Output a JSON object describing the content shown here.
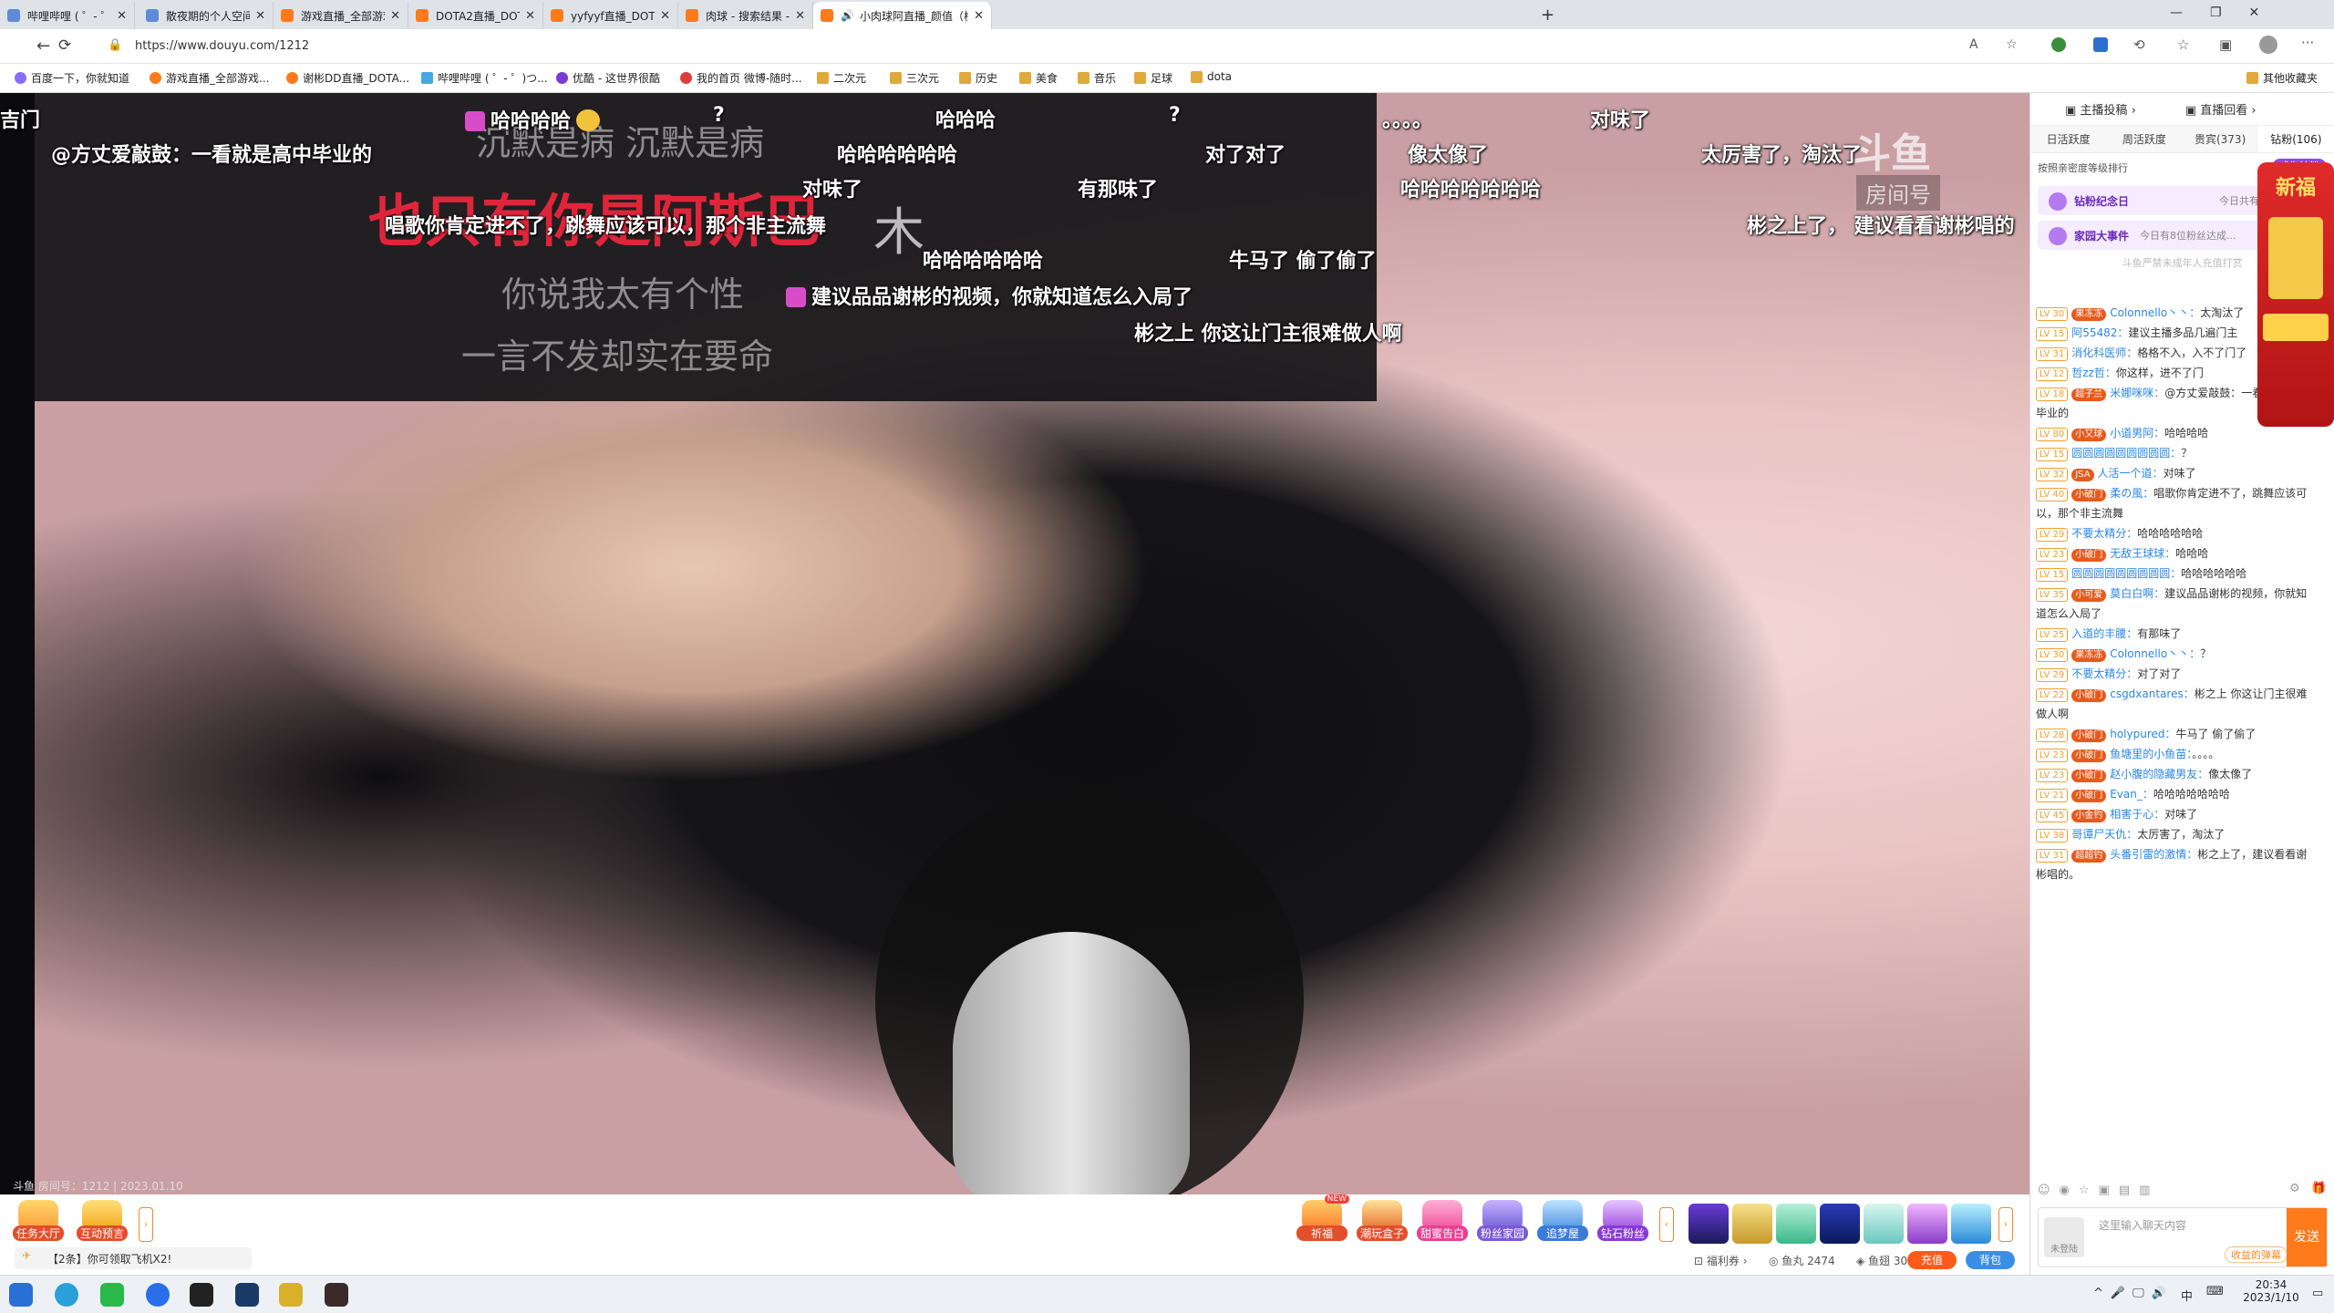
{
  "tabs": [
    {
      "title": "哔哩哔哩 ( ゜- ゜)つロ 干杯~-bili"
    },
    {
      "title": "散夜期的个人空间_哔哩哔哩_bili"
    },
    {
      "title": "游戏直播_全部游戏直播_斗鱼直播"
    },
    {
      "title": "DOTA2直播_DOTA2直播解说视频"
    },
    {
      "title": "yyfyyf直播_DOTA2直播_斗鱼直播"
    },
    {
      "title": "肉球 - 搜索结果 - 斗鱼直播 - 游戏"
    },
    {
      "title": "小肉球阿直播_颜值（横屏）"
    }
  ],
  "url": "https://www.douyu.com/1212",
  "bookmarks": [
    "百度一下，你就知道",
    "游戏直播_全部游戏...",
    "谢彬DD直播_DOTA...",
    "哔哩哔哩 ( ゜- ゜)つ...",
    "优酷 - 这世界很酷",
    "我的首页 微博-随时...",
    "二次元",
    "三次元",
    "历史",
    "美食",
    "音乐",
    "足球",
    "dota"
  ],
  "bookmark_other": "其他收藏夹",
  "lyrics": [
    "沉默是病 沉默是病",
    "也只有你是阿斯巴",
    "木",
    "你说我太有个性",
    "一言不发却实在要命"
  ],
  "danmaku": [
    "哈哈哈哈",
    "?",
    "哈哈哈",
    "?",
    "。。。。",
    "对味了",
    "@方丈爱敲鼓：一看就是高中毕业的",
    "哈哈哈哈哈哈",
    "对了对了",
    "像太像了",
    "太厉害了，淘汰了",
    "对味了",
    "有那味了",
    "哈哈哈哈哈哈哈",
    "唱歌你肯定进不了，跳舞应该可以，那个非主流舞",
    "彬之上了， 建议看看谢彬唱的",
    "哈哈哈哈哈哈",
    "牛马了 偷了偷了",
    "建议品品谢彬的视频，你就知道怎么入局了",
    "彬之上 你这让门主很难做人啊",
    "吉门"
  ],
  "watermark": "斗鱼",
  "watermark_sub": "房间号",
  "room_info": "斗鱼 房间号：1212 | 2023.01.10",
  "bottom": {
    "task": "任务大厅",
    "interact": "互动预言",
    "ticker": "【2条】你可领取飞机X2!",
    "gifts": [
      "祈福",
      "潮玩盒子",
      "甜蜜告白",
      "粉丝家园",
      "追梦屋",
      "钻石粉丝"
    ],
    "welfare": "福利券",
    "fishball_label": "鱼丸",
    "fishball": "2474",
    "fishwing_label": "鱼翅",
    "fishwing": "300",
    "recharge": "充值",
    "bag": "背包",
    "gift_new_badge": "NEW"
  },
  "panel": {
    "contrib": "主播投稿",
    "replay": "直播回看",
    "tabs": [
      "日活跃度",
      "周活跃度",
      "贵宾(373)",
      "钻粉(106)"
    ],
    "rank_text": "按照亲密度等级排行",
    "become": "成为钻粉",
    "banner1": "钻粉纪念日",
    "banner1_sub": "今日共有2位粉丝",
    "banner2": "家园大事件",
    "banner2_sub": "今日有8位粉丝达成...",
    "notice": "斗鱼严禁未成年人充值打赏",
    "chat": [
      {
        "lv": "LV 30",
        "badge": "果冻冻",
        "name": "Colonnello丶丶：",
        "text": "太淘汰了"
      },
      {
        "lv": "LV 15",
        "name": "阿55482：",
        "text": "建议主播多品几遍门主"
      },
      {
        "lv": "LV 31",
        "name": "消化科医师：",
        "text": "格格不入，入不了门了"
      },
      {
        "lv": "LV 12",
        "name": "哲zz哲：",
        "text": "你这样，进不了门"
      },
      {
        "lv": "LV 18",
        "badge": "超子兰",
        "name": "米娜咪咪：",
        "text": "@方丈爱敲鼓：一看就是高中毕业的"
      },
      {
        "lv": "LV 80",
        "badge": "小又球",
        "name": "小道男阿：",
        "text": "哈哈哈哈"
      },
      {
        "lv": "LV 15",
        "name": "圆圆圆圆圆圆圆圆圆：",
        "text": "？"
      },
      {
        "lv": "LV 32",
        "badge": "JSA",
        "name": "人活一个道：",
        "text": "对味了"
      },
      {
        "lv": "LV 40",
        "badge": "小破门",
        "name": "柔の風：",
        "text": "唱歌你肯定进不了，跳舞应该可以，那个非主流舞"
      },
      {
        "lv": "LV 29",
        "name": "不要太精分：",
        "text": "哈哈哈哈哈哈"
      },
      {
        "lv": "LV 23",
        "badge": "小破门",
        "name": "无敌王球球：",
        "text": "哈哈哈"
      },
      {
        "lv": "LV 15",
        "name": "圆圆圆圆圆圆圆圆圆：",
        "text": "哈哈哈哈哈哈"
      },
      {
        "lv": "LV 35",
        "badge": "小可爱",
        "name": "莫白白啊：",
        "text": "建议品品谢彬的视频，你就知道怎么入局了"
      },
      {
        "lv": "LV 25",
        "name": "入道的丰腰：",
        "text": "有那味了"
      },
      {
        "lv": "LV 30",
        "badge": "果冻冻",
        "name": "Colonnello丶丶：",
        "text": "？"
      },
      {
        "lv": "LV 29",
        "name": "不要太精分：",
        "text": "对了对了"
      },
      {
        "lv": "LV 22",
        "badge": "小破门",
        "name": "csgdxantares：",
        "text": "彬之上 你这让门主很难做人啊"
      },
      {
        "lv": "LV 28",
        "badge": "小破门",
        "name": "holypured：",
        "text": "牛马了 偷了偷了"
      },
      {
        "lv": "LV 23",
        "badge": "小破门",
        "name": "鱼塘里的小鱼苗：",
        "text": "。。。。"
      },
      {
        "lv": "LV 23",
        "badge": "小破门",
        "name": "赵小腹的隐藏男友：",
        "text": "像太像了"
      },
      {
        "lv": "LV 21",
        "badge": "小破门",
        "name": "Evan_：",
        "text": "哈哈哈哈哈哈哈"
      },
      {
        "lv": "LV 45",
        "badge": "小金钓",
        "name": "相害于心：",
        "text": "对味了"
      },
      {
        "lv": "LV 38",
        "name": "哥谭尸天仇：",
        "text": "太厉害了，淘汰了"
      },
      {
        "lv": "LV 31",
        "badge": "超超钓",
        "name": "头番引雷的激情：",
        "text": "彬之上了，建议看看谢彬唱的。"
      }
    ],
    "input_placeholder": "这里输入聊天内容",
    "send": "发送",
    "not_logged": "未登陆",
    "tail": "收益的弹幕"
  },
  "taskbar": {
    "time": "20:34",
    "date": "2023/1/10",
    "ime": "中"
  }
}
